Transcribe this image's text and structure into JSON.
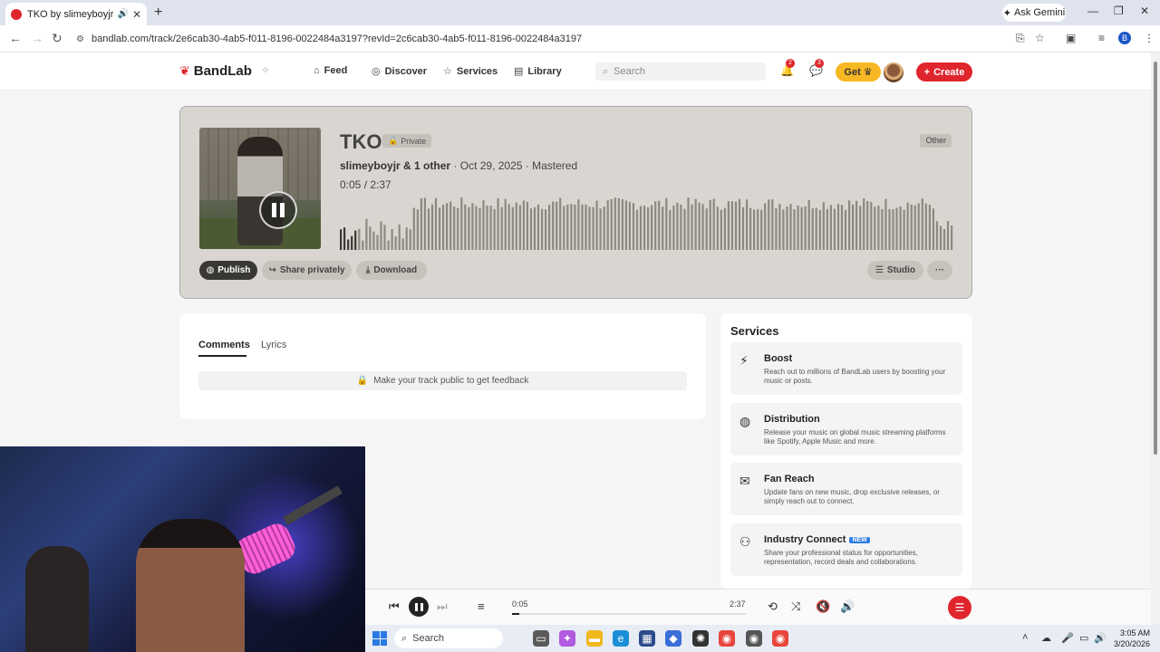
{
  "browser": {
    "tab_title": "TKO by slimeyboyjr | BandLab",
    "new_tab": "+",
    "ask_gemini": "Ask Gemini",
    "url": "bandlab.com/track/2e6cab30-4ab5-f011-8196-0022484a3197?revId=2c6cab30-4ab5-f011-8196-0022484a3197",
    "profile_initial": "B"
  },
  "header": {
    "logo": "BandLab",
    "nav": [
      "Feed",
      "Discover",
      "Services",
      "Library"
    ],
    "search_placeholder": "Search",
    "notifications_count": "2",
    "messages_count": "3",
    "get_label": "Get",
    "create_label": "Create"
  },
  "track": {
    "title": "TKO",
    "visibility": "Private",
    "genre": "Other",
    "artist": "slimeyboyjr",
    "collab": "& 1 other",
    "date": "· Oct 29, 2025 · Mastered",
    "time": "0:05 /  2:37",
    "progress_fraction": 0.032,
    "buttons": {
      "publish": "Publish",
      "share": "Share privately",
      "download": "Download",
      "studio": "Studio",
      "more": "···"
    }
  },
  "comments": {
    "tabs": [
      "Comments",
      "Lyrics"
    ],
    "notice": "Make your track public to get feedback"
  },
  "services": {
    "title": "Services",
    "items": [
      {
        "name": "Boost",
        "desc": "Reach out to millions of BandLab users by boosting your music or posts.",
        "icon": "bolt-icon"
      },
      {
        "name": "Distribution",
        "desc": "Release your music on global music streaming platforms like Spotify, Apple Music and more.",
        "icon": "globe-icon"
      },
      {
        "name": "Fan Reach",
        "desc": "Update fans on new music, drop exclusive releases, or simply reach out to connect.",
        "icon": "mail-icon"
      },
      {
        "name": "Industry Connect",
        "badge": "NEW",
        "desc": "Share your professional status for opportunities, representation, record deals and collaborations.",
        "icon": "people-icon"
      }
    ]
  },
  "player": {
    "current": "0:05",
    "duration": "2:37",
    "progress_fraction": 0.032
  },
  "taskbar": {
    "search": "Search",
    "time": "3:05 AM",
    "date": "3/20/2026"
  }
}
